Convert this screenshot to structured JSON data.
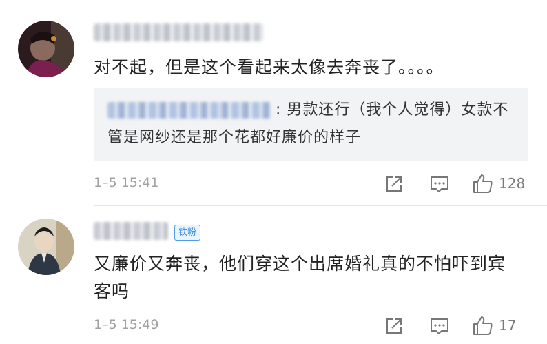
{
  "comments": [
    {
      "text": "对不起，但是这个看起来太像去奔丧了。。。。",
      "quote": {
        "text": ": 男款还行（我个人觉得）女款不管是网纱还是那个花都好廉价的样子"
      },
      "time": "1–5 15:41",
      "likes": "128"
    },
    {
      "badge": "铁粉",
      "text": "又廉价又奔丧，他们穿这个出席婚礼真的不怕吓到宾客吗",
      "time": "1–5 15:49",
      "likes": "17"
    }
  ],
  "icons": {
    "share": "share-icon",
    "comment": "comment-icon",
    "like": "thumbs-up-icon"
  },
  "colors": {
    "fan_badge": "#2f86e0",
    "quote_background": "#f2f3f5",
    "meta_text": "#a1a1a1"
  }
}
